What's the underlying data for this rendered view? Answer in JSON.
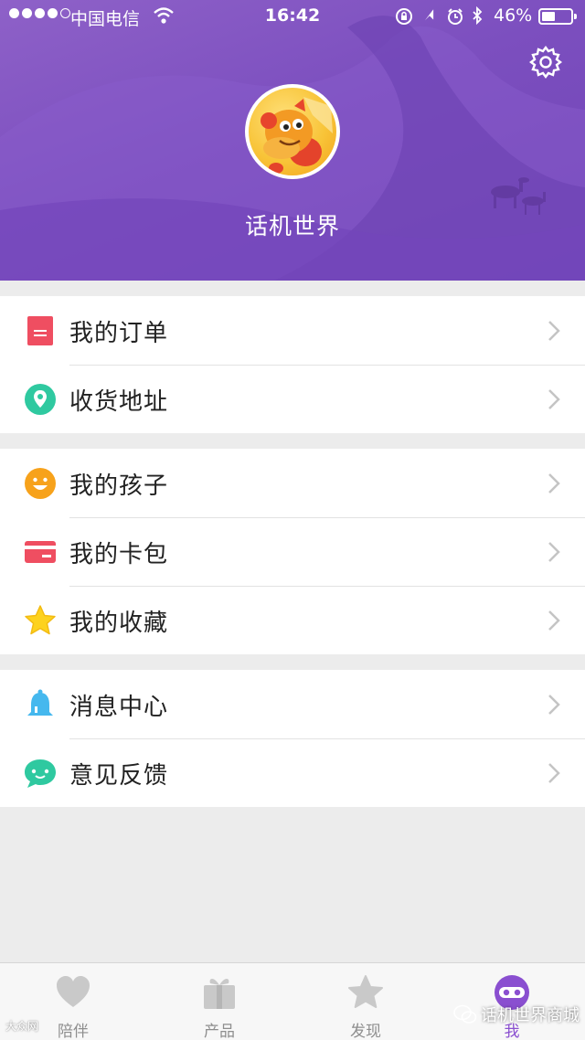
{
  "status_bar": {
    "carrier": "中国电信",
    "time": "16:42",
    "battery": "46%",
    "battery_level": 0.46
  },
  "profile": {
    "username": "话机世界"
  },
  "menu_groups": [
    {
      "items": [
        {
          "label": "我的订单",
          "icon": "order-icon",
          "color": "#ef4e61"
        },
        {
          "label": "收货地址",
          "icon": "location-icon",
          "color": "#2fc9a0"
        }
      ]
    },
    {
      "items": [
        {
          "label": "我的孩子",
          "icon": "smiley-icon",
          "color": "#f7a21b"
        },
        {
          "label": "我的卡包",
          "icon": "card-icon",
          "color": "#ef4e61"
        },
        {
          "label": "我的收藏",
          "icon": "star-icon",
          "color": "#fdd21e"
        }
      ]
    },
    {
      "items": [
        {
          "label": "消息中心",
          "icon": "bell-icon",
          "color": "#45b8ee"
        },
        {
          "label": "意见反馈",
          "icon": "chat-icon",
          "color": "#2fc9a0"
        }
      ]
    }
  ],
  "tabbar": {
    "tabs": [
      {
        "label": "陪伴",
        "icon": "heart-icon"
      },
      {
        "label": "产品",
        "icon": "gift-icon"
      },
      {
        "label": "发现",
        "icon": "star-icon"
      },
      {
        "label": "我",
        "icon": "robot-face-icon"
      }
    ],
    "active_index": 3
  },
  "watermark": {
    "text": "话机世界商城",
    "small_text": "大众网"
  },
  "colors": {
    "accent": "#8a4fd0",
    "header": "#7c4fbf",
    "background": "#ececec"
  }
}
